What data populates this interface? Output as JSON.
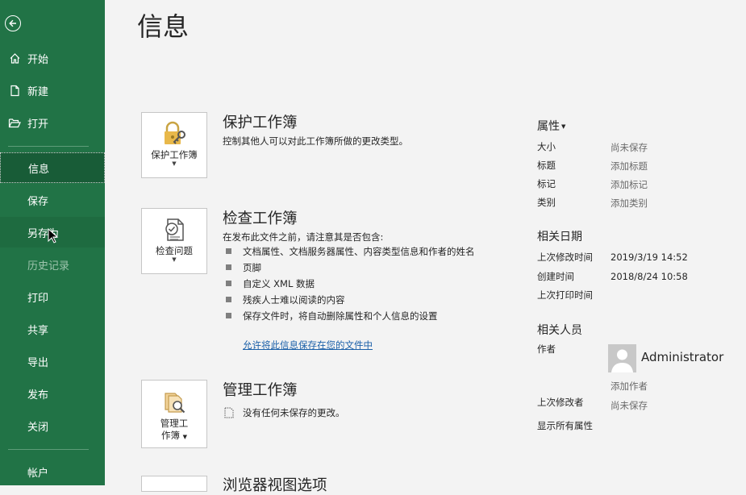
{
  "sidebar": {
    "items": [
      {
        "label": "开始"
      },
      {
        "label": "新建"
      },
      {
        "label": "打开"
      },
      {
        "label": "信息"
      },
      {
        "label": "保存"
      },
      {
        "label": "另存为"
      },
      {
        "label": "历史记录"
      },
      {
        "label": "打印"
      },
      {
        "label": "共享"
      },
      {
        "label": "导出"
      },
      {
        "label": "发布"
      },
      {
        "label": "关闭"
      },
      {
        "label": "帐户"
      }
    ]
  },
  "page_title": "信息",
  "protect": {
    "button_label": "保护工作簿",
    "title": "保护工作簿",
    "description": "控制其他人可以对此工作簿所做的更改类型。"
  },
  "inspect": {
    "button_label": "检查问题",
    "title": "检查工作簿",
    "intro": "在发布此文件之前，请注意其是否包含:",
    "bullets": [
      "文档属性、文档服务器属性、内容类型信息和作者的姓名",
      "页脚",
      "自定义 XML 数据",
      "残疾人士难以阅读的内容",
      "保存文件时，将自动删除属性和个人信息的设置"
    ],
    "link": "允许将此信息保存在您的文件中"
  },
  "manage": {
    "button_label_1": "管理工",
    "button_label_2": "作簿",
    "title": "管理工作簿",
    "description": "没有任何未保存的更改。"
  },
  "browser": {
    "title": "浏览器视图选项"
  },
  "properties": {
    "heading": "属性",
    "rows": [
      {
        "label": "大小",
        "value": "尚未保存"
      },
      {
        "label": "标题",
        "value": "添加标题"
      },
      {
        "label": "标记",
        "value": "添加标记"
      },
      {
        "label": "类别",
        "value": "添加类别"
      }
    ]
  },
  "dates": {
    "heading": "相关日期",
    "rows": [
      {
        "label": "上次修改时间",
        "value": "2019/3/19 14:52"
      },
      {
        "label": "创建时间",
        "value": "2018/8/24 10:58"
      },
      {
        "label": "上次打印时间",
        "value": ""
      }
    ]
  },
  "people": {
    "heading": "相关人员",
    "author_label": "作者",
    "author_name": "Administrator",
    "add_author": "添加作者",
    "last_modified_by_label": "上次修改者",
    "last_modified_by_value": "尚未保存",
    "show_all": "显示所有属性"
  },
  "colors": {
    "sidebar_bg": "#217346",
    "sidebar_active": "#185c37",
    "link": "#1a5fa8"
  }
}
